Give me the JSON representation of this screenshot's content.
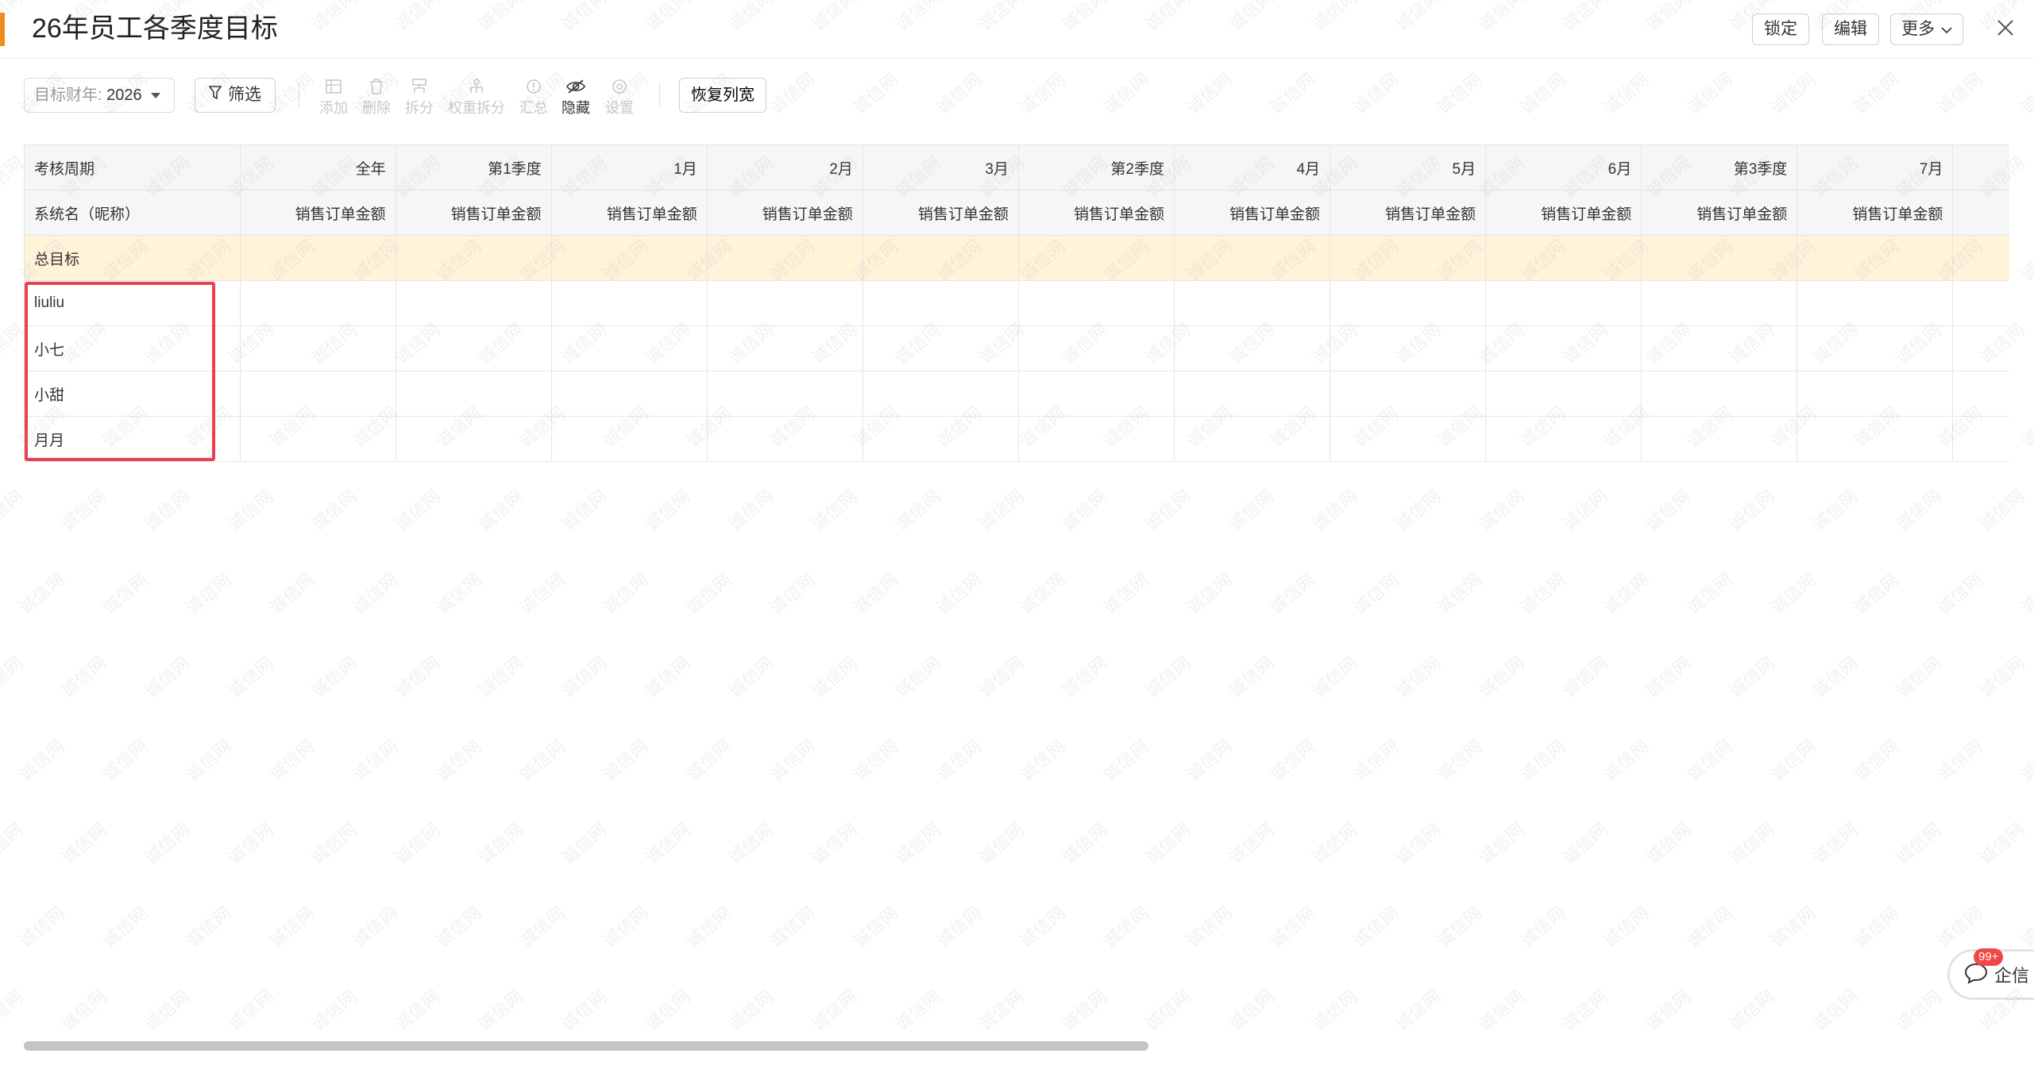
{
  "header": {
    "title": "26年员工各季度目标",
    "lock_label": "锁定",
    "edit_label": "编辑",
    "more_label": "更多"
  },
  "toolbar": {
    "year_label": "目标财年:",
    "year_value": "2026",
    "filter_label": "筛选",
    "tools": [
      {
        "label": "添加",
        "icon": "add-row-icon",
        "enabled": false
      },
      {
        "label": "删除",
        "icon": "trash-icon",
        "enabled": false
      },
      {
        "label": "拆分",
        "icon": "split-icon",
        "enabled": false
      },
      {
        "label": "权重拆分",
        "icon": "weight-split-icon",
        "enabled": false
      },
      {
        "label": "汇总",
        "icon": "summary-icon",
        "enabled": false
      },
      {
        "label": "隐藏",
        "icon": "eye-hidden-icon",
        "enabled": true
      },
      {
        "label": "设置",
        "icon": "settings-icon",
        "enabled": false
      }
    ],
    "restore_label": "恢复列宽"
  },
  "table": {
    "period_label": "考核周期",
    "name_label": "系统名（昵称）",
    "periods": [
      "全年",
      "第1季度",
      "1月",
      "2月",
      "3月",
      "第2季度",
      "4月",
      "5月",
      "6月",
      "第3季度",
      "7月"
    ],
    "metric": "销售订单金额",
    "total_label": "总目标",
    "rows": [
      "liuliu",
      "小七",
      "小甜",
      "月月"
    ]
  },
  "chat": {
    "label": "企信",
    "badge": "99+"
  },
  "watermark": "诚信网"
}
